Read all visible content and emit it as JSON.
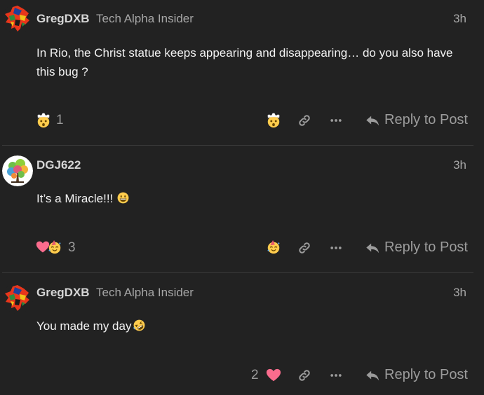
{
  "posts": [
    {
      "username": "GregDXB",
      "user_title": "Tech Alpha Insider",
      "time": "3h",
      "body": "In Rio, the Christ statue keeps appearing and disappearing… do you also have this bug ?",
      "reactions": {
        "icons": [
          "exploding-head-emoji"
        ],
        "count": "1"
      },
      "reply_label": "Reply to Post"
    },
    {
      "username": "DGJ622",
      "user_title": "",
      "time": "3h",
      "body": "It’s a Miracle!!!",
      "body_emoji": "grinning-face-emoji",
      "reactions": {
        "icons": [
          "heart-emoji",
          "partying-face-emoji"
        ],
        "count": "3"
      },
      "reply_label": "Reply to Post"
    },
    {
      "username": "GregDXB",
      "user_title": "Tech Alpha Insider",
      "time": "3h",
      "body": "You made my day",
      "body_emoji": "rolling-laughing-emoji",
      "like_count": "2",
      "reply_label": "Reply to Post"
    }
  ],
  "colors": {
    "background": "#222222",
    "heart": "#fa6c8d",
    "emoji_yellow": "#ffcc4d"
  }
}
